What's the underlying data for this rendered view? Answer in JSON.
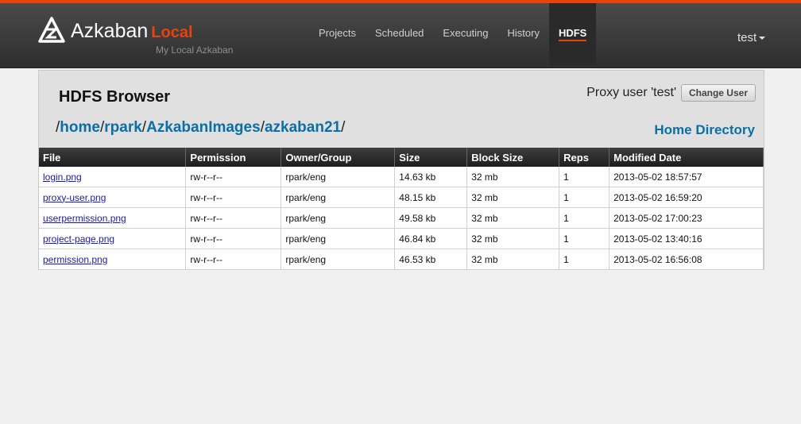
{
  "header": {
    "brand_name": "Azkaban",
    "brand_suffix": "Local",
    "tagline": "My Local Azkaban",
    "logo_icon": "azkaban-logo-icon",
    "accent_color": "#e8430e",
    "nav": [
      {
        "label": "Projects",
        "active": false
      },
      {
        "label": "Scheduled",
        "active": false
      },
      {
        "label": "Executing",
        "active": false
      },
      {
        "label": "History",
        "active": false
      },
      {
        "label": "HDFS",
        "active": true
      }
    ],
    "user": "test"
  },
  "panel": {
    "title": "HDFS Browser",
    "proxy_text": "Proxy user 'test'",
    "change_user_label": "Change User",
    "breadcrumb": [
      "home",
      "rpark",
      "AzkabanImages",
      "azkaban21"
    ],
    "home_directory_label": "Home Directory"
  },
  "table": {
    "columns": [
      "File",
      "Permission",
      "Owner/Group",
      "Size",
      "Block Size",
      "Reps",
      "Modified Date"
    ],
    "rows": [
      [
        "login.png",
        "rw-r--r--",
        "rpark/eng",
        "14.63 kb",
        "32 mb",
        "1",
        "2013-05-02 18:57:57"
      ],
      [
        "proxy-user.png",
        "rw-r--r--",
        "rpark/eng",
        "48.15 kb",
        "32 mb",
        "1",
        "2013-05-02 16:59:20"
      ],
      [
        "userpermission.png",
        "rw-r--r--",
        "rpark/eng",
        "49.58 kb",
        "32 mb",
        "1",
        "2013-05-02 17:00:23"
      ],
      [
        "project-page.png",
        "rw-r--r--",
        "rpark/eng",
        "46.84 kb",
        "32 mb",
        "1",
        "2013-05-02 13:40:16"
      ],
      [
        "permission.png",
        "rw-r--r--",
        "rpark/eng",
        "46.53 kb",
        "32 mb",
        "1",
        "2013-05-02 16:56:08"
      ]
    ]
  }
}
